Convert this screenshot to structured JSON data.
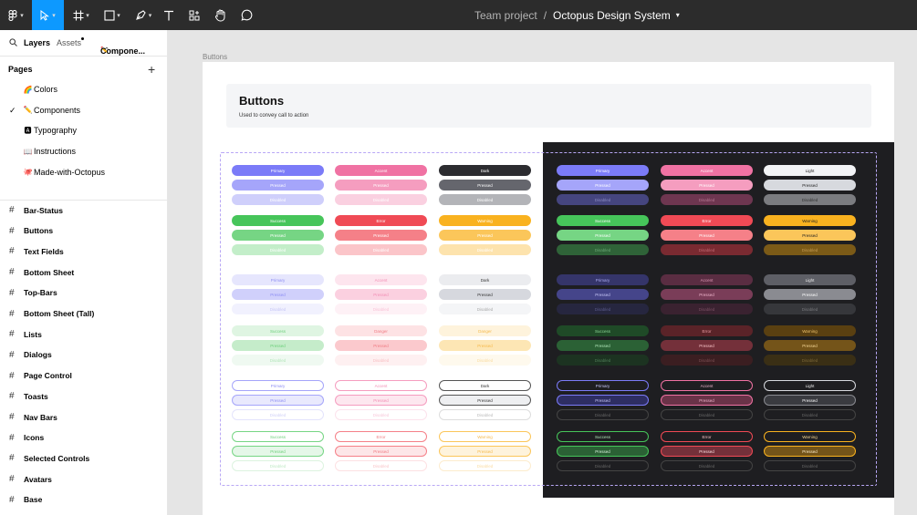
{
  "toolbar": {
    "tools": [
      "main-menu-icon",
      "move-tool-icon",
      "frame-tool-icon",
      "shape-tool-icon",
      "pen-tool-icon",
      "text-tool-icon",
      "resources-icon",
      "hand-tool-icon",
      "comment-icon"
    ]
  },
  "breadcrumb": {
    "project": "Team project",
    "separator": "/",
    "file": "Octopus Design System"
  },
  "sidebar": {
    "tabs": {
      "layers": "Layers",
      "assets": "Assets",
      "page": "Compone..."
    },
    "pages_title": "Pages",
    "pages": [
      {
        "emoji": "🌈",
        "label": "Colors"
      },
      {
        "emoji": "✏️",
        "label": "Components",
        "active": true
      },
      {
        "emoji": "🅰",
        "label": "Typography"
      },
      {
        "emoji": "📖",
        "label": "Instructions"
      },
      {
        "emoji": "🐙",
        "label": "Made-with-Octopus"
      }
    ],
    "frames": [
      "Bar-Status",
      "Buttons",
      "Text Fields",
      "Bottom Sheet",
      "Top-Bars",
      "Bottom Sheet (Tall)",
      "Lists",
      "Dialogs",
      "Page Control",
      "Toasts",
      "Nav Bars",
      "Icons",
      "Selected Controls",
      "Avatars",
      "Base"
    ]
  },
  "canvas": {
    "frame_label": "Buttons"
  },
  "card": {
    "title": "Buttons",
    "subtitle": "Used to convey call to action"
  },
  "buttons": {
    "light": [
      [
        [
          "Primary",
          "#7b7bf8",
          "#fff"
        ],
        [
          "Accent",
          "#f072a3",
          "#fff"
        ],
        [
          "Dark",
          "#2c2c30",
          "#fff"
        ]
      ],
      [
        [
          "Pressed",
          "#a5a5fa",
          "#fff"
        ],
        [
          "Pressed",
          "#f59dbf",
          "#fff"
        ],
        [
          "Pressed",
          "#65666d",
          "#fff"
        ]
      ],
      [
        [
          "Disabled",
          "#cfcffb",
          "#fff"
        ],
        [
          "Disabled",
          "#fad0e0",
          "#fff"
        ],
        [
          "Disabled",
          "#b3b4b8",
          "#fff"
        ]
      ],
      [
        [
          "Success",
          "#46c55a",
          "#fff"
        ],
        [
          "Error",
          "#f04a55",
          "#fff"
        ],
        [
          "Warning",
          "#f9b21f",
          "#fff"
        ]
      ],
      [
        [
          "Pressed",
          "#76d584",
          "#fff"
        ],
        [
          "Pressed",
          "#f58088",
          "#fff"
        ],
        [
          "Pressed",
          "#fbc65a",
          "#fff"
        ]
      ],
      [
        [
          "Disabled",
          "#c3eec9",
          "#fff"
        ],
        [
          "Disabled",
          "#fbc5c9",
          "#fff"
        ],
        [
          "Disabled",
          "#fde3ad",
          "#fff"
        ]
      ],
      [
        [
          "Primary",
          "#e6e6fd",
          "#8d8df3"
        ],
        [
          "Accent",
          "#fde5ee",
          "#f28db4"
        ],
        [
          "Dark",
          "#ebecef",
          "#333"
        ]
      ],
      [
        [
          "Pressed",
          "#d0d0fb",
          "#8d8df3"
        ],
        [
          "Pressed",
          "#fbd0e0",
          "#f28db4"
        ],
        [
          "Pressed",
          "#d6d8de",
          "#333"
        ]
      ],
      [
        [
          "Disabled",
          "#f1f1fe",
          "#c6c6f6"
        ],
        [
          "Disabled",
          "#fef1f6",
          "#f8c3d7"
        ],
        [
          "Disabled",
          "#f4f5f7",
          "#aaa"
        ]
      ],
      [
        [
          "Success",
          "#dff5e2",
          "#6bcf79"
        ],
        [
          "Danger",
          "#fde2e4",
          "#f07a82"
        ],
        [
          "Danger",
          "#fef3dc",
          "#f5b94b"
        ]
      ],
      [
        [
          "Pressed",
          "#c5ecca",
          "#6bcf79"
        ],
        [
          "Pressed",
          "#fbc9cd",
          "#f07a82"
        ],
        [
          "Pressed",
          "#fde6b4",
          "#f5b94b"
        ]
      ],
      [
        [
          "Disabled",
          "#eff9f1",
          "#b3e6ba"
        ],
        [
          "Disabled",
          "#fef0f1",
          "#f8c0c4"
        ],
        [
          "Disabled",
          "#fef9ed",
          "#fadca2"
        ]
      ],
      [
        [
          "Primary",
          "#ffffff",
          "#8d8df3",
          "#a5a5fa"
        ],
        [
          "Accent",
          "#ffffff",
          "#f28db4",
          "#f59dbf"
        ],
        [
          "Dark",
          "#ffffff",
          "#333",
          "#555"
        ]
      ],
      [
        [
          "Pressed",
          "#e9e9fd",
          "#8d8df3",
          "#a5a5fa"
        ],
        [
          "Pressed",
          "#fde7ef",
          "#f28db4",
          "#f59dbf"
        ],
        [
          "Pressed",
          "#eeeff1",
          "#333",
          "#555"
        ]
      ],
      [
        [
          "Disabled",
          "#ffffff",
          "#d0d0f7",
          "#e3e3fc"
        ],
        [
          "Disabled",
          "#ffffff",
          "#f8c8da",
          "#fce2ec"
        ],
        [
          "Disabled",
          "#ffffff",
          "#bbb",
          "#ddd"
        ]
      ],
      [
        [
          "Success",
          "#ffffff",
          "#6bcf79",
          "#76d584"
        ],
        [
          "Error",
          "#ffffff",
          "#f07a82",
          "#f58088"
        ],
        [
          "Warning",
          "#ffffff",
          "#f5b94b",
          "#fbc65a"
        ]
      ],
      [
        [
          "Pressed",
          "#e5f7e8",
          "#6bcf79",
          "#76d584"
        ],
        [
          "Pressed",
          "#fde6e8",
          "#f07a82",
          "#f58088"
        ],
        [
          "Pressed",
          "#fef3dc",
          "#f5b94b",
          "#fbc65a"
        ]
      ],
      [
        [
          "Disabled",
          "#ffffff",
          "#bfe9c5",
          "#dcf3df"
        ],
        [
          "Disabled",
          "#ffffff",
          "#f9c5c9",
          "#fde0e2"
        ],
        [
          "Disabled",
          "#ffffff",
          "#fadca2",
          "#fdeccd"
        ]
      ]
    ],
    "dark": [
      [
        [
          "Primary",
          "#7b7bf8",
          "#fff"
        ],
        [
          "Accent",
          "#f072a3",
          "#fff"
        ],
        [
          "Light",
          "#f3f4f6",
          "#222"
        ]
      ],
      [
        [
          "Pressed",
          "#a5a5fa",
          "#fff"
        ],
        [
          "Pressed",
          "#f59dbf",
          "#fff"
        ],
        [
          "Pressed",
          "#d7d9de",
          "#222"
        ]
      ],
      [
        [
          "Disabled",
          "#45457f",
          "#8a8ac0"
        ],
        [
          "Disabled",
          "#6e3650",
          "#b57892"
        ],
        [
          "Disabled",
          "#7b7c80",
          "#333"
        ]
      ],
      [
        [
          "Success",
          "#46c55a",
          "#fff"
        ],
        [
          "Error",
          "#f04a55",
          "#fff"
        ],
        [
          "Warning",
          "#f9b21f",
          "#222"
        ]
      ],
      [
        [
          "Pressed",
          "#76d584",
          "#fff"
        ],
        [
          "Pressed",
          "#f58088",
          "#fff"
        ],
        [
          "Pressed",
          "#fbc65a",
          "#222"
        ]
      ],
      [
        [
          "Disabled",
          "#2f6338",
          "#6aa574"
        ],
        [
          "Disabled",
          "#7a2a31",
          "#c06a72"
        ],
        [
          "Disabled",
          "#7b5a17",
          "#c29a52"
        ]
      ],
      [
        [
          "Primary",
          "#35356a",
          "#aaaaf0"
        ],
        [
          "Accent",
          "#5a2d42",
          "#e19ab9"
        ],
        [
          "Light",
          "#5e5f66",
          "#eee"
        ]
      ],
      [
        [
          "Pressed",
          "#45458a",
          "#c7c7f7"
        ],
        [
          "Pressed",
          "#7a3d58",
          "#f0b5cd"
        ],
        [
          "Pressed",
          "#8a8b91",
          "#fff"
        ]
      ],
      [
        [
          "Disabled",
          "#26263f",
          "#5a5a8a"
        ],
        [
          "Disabled",
          "#3a2230",
          "#7a5064"
        ],
        [
          "Disabled",
          "#36373b",
          "#77787c"
        ]
      ],
      [
        [
          "Success",
          "#1f4a27",
          "#8fd99a"
        ],
        [
          "Error",
          "#5a2328",
          "#f0a0a6"
        ],
        [
          "Warning",
          "#5a4011",
          "#f0c46c"
        ]
      ],
      [
        [
          "Pressed",
          "#2b6135",
          "#b1e7b9"
        ],
        [
          "Pressed",
          "#74303a",
          "#f7c3c7"
        ],
        [
          "Pressed",
          "#745419",
          "#f7d896"
        ]
      ],
      [
        [
          "Disabled",
          "#1c3321",
          "#4f7d57"
        ],
        [
          "Disabled",
          "#3b1e21",
          "#7a4e52"
        ],
        [
          "Disabled",
          "#3a2f15",
          "#7a6738"
        ]
      ],
      [
        [
          "Primary",
          "#1e1e21",
          "#c7c7f7",
          "#7b7bf8"
        ],
        [
          "Accent",
          "#1e1e21",
          "#f0b5cd",
          "#f072a3"
        ],
        [
          "Light",
          "#1e1e21",
          "#eee",
          "#d7d9de"
        ]
      ],
      [
        [
          "Pressed",
          "#2e2e63",
          "#c7c7f7",
          "#7b7bf8"
        ],
        [
          "Pressed",
          "#6a3348",
          "#f0b5cd",
          "#f072a3"
        ],
        [
          "Pressed",
          "#3a3b40",
          "#fff",
          "#8a8b91"
        ]
      ],
      [
        [
          "Disabled",
          "#1e1e21",
          "#666",
          "#444"
        ],
        [
          "Disabled",
          "#1e1e21",
          "#666",
          "#444"
        ],
        [
          "Disabled",
          "#1e1e21",
          "#666",
          "#444"
        ]
      ],
      [
        [
          "Success",
          "#1e1e21",
          "#b1e7b9",
          "#46c55a"
        ],
        [
          "Error",
          "#1e1e21",
          "#f7c3c7",
          "#f04a55"
        ],
        [
          "Warning",
          "#1e1e21",
          "#f7d896",
          "#f9b21f"
        ]
      ],
      [
        [
          "Pressed",
          "#2b6135",
          "#ddf5e1",
          "#46c55a"
        ],
        [
          "Pressed",
          "#74303a",
          "#fde3e5",
          "#f04a55"
        ],
        [
          "Pressed",
          "#745419",
          "#fdefcf",
          "#f9b21f"
        ]
      ],
      [
        [
          "Disabled",
          "#1e1e21",
          "#666",
          "#444"
        ],
        [
          "Disabled",
          "#1e1e21",
          "#666",
          "#444"
        ],
        [
          "Disabled",
          "#1e1e21",
          "#666",
          "#444"
        ]
      ]
    ]
  }
}
